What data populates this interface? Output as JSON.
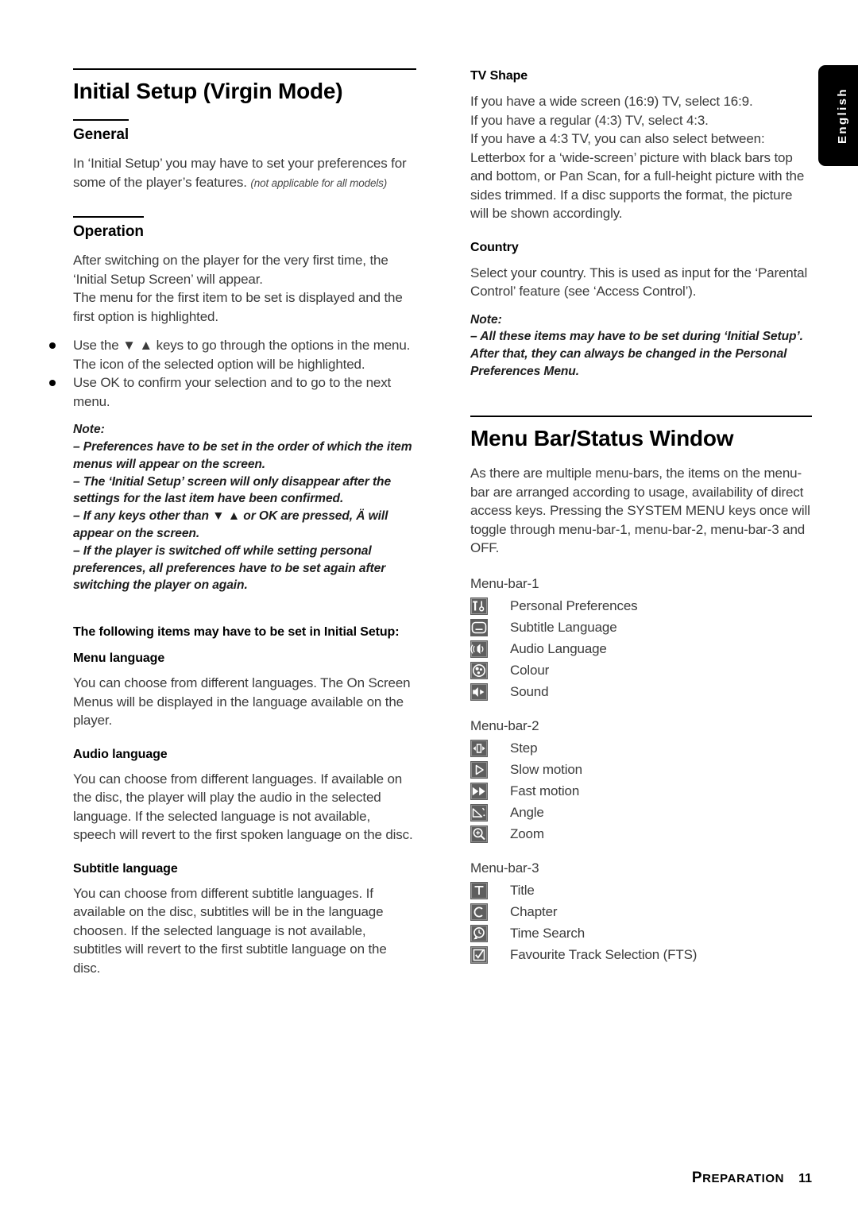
{
  "language_tab": {
    "label": "English"
  },
  "left_column": {
    "title": "Initial Setup (Virgin Mode)",
    "general": {
      "heading": "General",
      "paragraph": "In ‘Initial Setup’ you may have to set your preferences for some of the player’s features.",
      "paragraph_italic_tail": "(not applicable for all models)"
    },
    "operation": {
      "heading": "Operation",
      "paragraph1": "After switching on the player for the very first time, the ‘Initial Setup Screen’ will appear.",
      "paragraph2": "The menu for the first item to be set is displayed and the first option is highlighted.",
      "bullets": [
        "Use the ▼ ▲ keys to go through the options in the menu. The icon of the selected option will be highlighted.",
        "Use OK to confirm your selection and to go to the next menu."
      ],
      "note_label": "Note:",
      "notes": [
        "–  Preferences have to be set in the order of which the item menus will appear on the screen.",
        "–  The ‘Initial Setup’ screen will only disappear after the settings for the last item have been confirmed.",
        "–  If any keys other than ▼ ▲ or OK are pressed, Ä  will appear on the screen.",
        "–  If the player is switched off while setting personal preferences, all preferences have to be set again after switching the player on again."
      ]
    },
    "items_intro": "The following items may have to be set in Initial Setup:",
    "sections": [
      {
        "heading": "Menu language",
        "body": "You can choose from different languages. The On Screen Menus will be displayed in the language available on the player."
      },
      {
        "heading": "Audio language",
        "body": "You can choose from different languages. If available on the disc, the player will play the audio in the selected language. If the selected language is not available, speech will revert to the first spoken language on the disc."
      },
      {
        "heading": "Subtitle language",
        "body": "You can choose from different subtitle languages. If available on the disc, subtitles will be in the language choosen. If the selected language is not available, subtitles will revert to the first subtitle language on the disc."
      }
    ]
  },
  "right_column": {
    "tv_shape": {
      "heading": "TV Shape",
      "lines": [
        "If you have a wide screen (16:9) TV, select 16:9.",
        "If you have a regular (4:3) TV, select 4:3.",
        "If you have a 4:3 TV, you can also select between:",
        "Letterbox for a ‘wide-screen’ picture with black bars top and bottom, or Pan Scan, for a full-height picture with the sides trimmed. If a disc supports the format, the picture will be shown accordingly."
      ]
    },
    "country": {
      "heading": "Country",
      "body": "Select your country. This is used as input for the ‘Parental Control’ feature (see ‘Access Control’).",
      "note_label": "Note:",
      "note": "–  All these items may have to be set during ‘Initial Setup’. After that, they can always be changed in the Personal Preferences Menu."
    },
    "menu_bar": {
      "title": "Menu Bar/Status Window",
      "intro": "As there are multiple menu-bars, the items on the menu-bar are arranged according to usage, availability of direct access keys. Pressing the SYSTEM MENU keys once will toggle through menu-bar-1, menu-bar-2, menu-bar-3 and OFF.",
      "groups": [
        {
          "label": "Menu-bar-1",
          "items": [
            {
              "icon": "tools-icon",
              "label": "Personal Preferences"
            },
            {
              "icon": "subtitle-icon",
              "label": "Subtitle Language"
            },
            {
              "icon": "audio-icon",
              "label": "Audio Language"
            },
            {
              "icon": "colour-icon",
              "label": "Colour"
            },
            {
              "icon": "sound-icon",
              "label": "Sound"
            }
          ]
        },
        {
          "label": "Menu-bar-2",
          "items": [
            {
              "icon": "step-icon",
              "label": "Step"
            },
            {
              "icon": "slow-motion-icon",
              "label": "Slow motion"
            },
            {
              "icon": "fast-motion-icon",
              "label": "Fast motion"
            },
            {
              "icon": "angle-icon",
              "label": "Angle"
            },
            {
              "icon": "zoom-icon",
              "label": "Zoom"
            }
          ]
        },
        {
          "label": "Menu-bar-3",
          "items": [
            {
              "icon": "title-icon",
              "label": "Title"
            },
            {
              "icon": "chapter-icon",
              "label": "Chapter"
            },
            {
              "icon": "time-search-icon",
              "label": "Time Search"
            },
            {
              "icon": "fts-icon",
              "label": "Favourite Track Selection (FTS)"
            }
          ]
        }
      ]
    }
  },
  "footer": {
    "section_first": "P",
    "section_rest": "REPARATION",
    "page_number": "11"
  }
}
